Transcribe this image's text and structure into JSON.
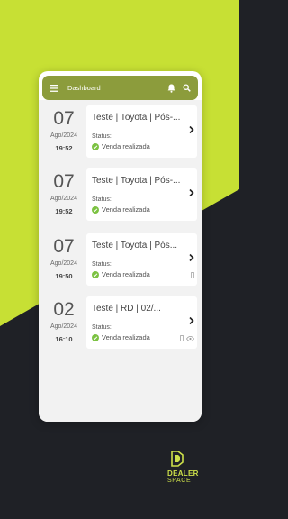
{
  "colors": {
    "lime": "#c7e034",
    "dark": "#1f2126",
    "appbar": "#8c9c3c",
    "success": "#7cc242"
  },
  "header": {
    "title": "Dashboard"
  },
  "items": [
    {
      "day": "07",
      "month": "Ago/2024",
      "time": "19:52",
      "name": "Teste | Toyota | Pós-...",
      "status_label": "Status:",
      "status_value": "Venda realizada"
    },
    {
      "day": "07",
      "month": "Ago/2024",
      "time": "19:52",
      "name": "Teste | Toyota | Pós-...",
      "status_label": "Status:",
      "status_value": "Venda realizada"
    },
    {
      "day": "07",
      "month": "Ago/2024",
      "time": "19:50",
      "name": "Teste | Toyota | Pós...",
      "status_label": "Status:",
      "status_value": "Venda realizada"
    },
    {
      "day": "02",
      "month": "Ago/2024",
      "time": "16:10",
      "name": "Teste | RD | 02/...",
      "status_label": "Status:",
      "status_value": "Venda realizada"
    }
  ],
  "brand": {
    "line1": "DEALER",
    "line2": "SPACE"
  }
}
